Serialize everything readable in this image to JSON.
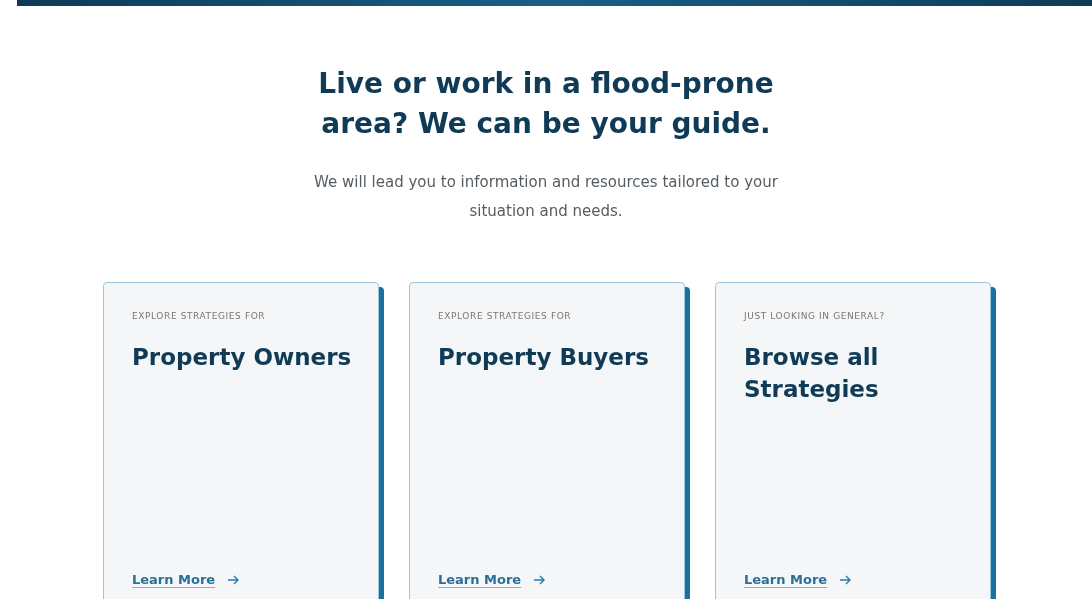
{
  "heading": "Live or work in a flood-prone area? We can be your guide.",
  "intro": "We will lead you to information and resources tailored to your situation and needs.",
  "cards": [
    {
      "eyebrow": "EXPLORE STRATEGIES FOR",
      "title": "Property Owners",
      "link": "Learn More"
    },
    {
      "eyebrow": "EXPLORE STRATEGIES FOR",
      "title": "Property Buyers",
      "link": "Learn More"
    },
    {
      "eyebrow": "JUST LOOKING IN GENERAL?",
      "title": "Browse all Strategies",
      "link": "Learn More"
    }
  ]
}
